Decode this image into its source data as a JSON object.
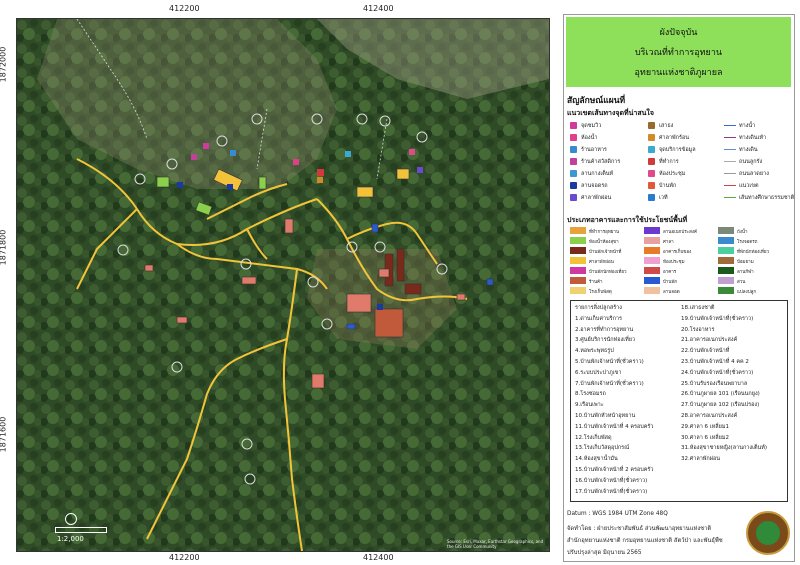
{
  "map": {
    "x_ticks": [
      "412200",
      "412400",
      "412200",
      "412400"
    ],
    "y_ticks": [
      "1872000",
      "1871800",
      "1871600",
      "1872000",
      "1871800",
      "1871600"
    ],
    "scale_label": "1:2,000",
    "attribution": "Source: Esri, Maxar, Earthstar Geographics, and the GIS User Community"
  },
  "title": {
    "line1": "ผังปัจจุบัน",
    "line2": "บริเวณที่ทำการอุทยาน",
    "line3": "อุทยานแห่งชาติภูผายล"
  },
  "legend": {
    "heading": "สัญลักษณ์แผนที่",
    "subheading": "แนวเขตเส้นทางจุดที่น่าสนใจ",
    "items": [
      {
        "label": "จุดชมวิว",
        "color": "#d03a9a"
      },
      {
        "label": "ห้องน้ำ",
        "color": "#e0408a"
      },
      {
        "label": "ร้านอาหาร",
        "color": "#3a8ad0"
      },
      {
        "label": "ร้านค้าสวัสดิการ",
        "color": "#c0409a"
      },
      {
        "label": "ลานกางเต็นท์",
        "color": "#3a9ad0"
      },
      {
        "label": "ลานจอดรถ",
        "color": "#1a3aa0"
      },
      {
        "label": "ศาลาพักผ่อน",
        "color": "#6a4ad0"
      },
      {
        "label": "เสาธง",
        "color": "#9a6a2a"
      },
      {
        "label": "ศาลาพักร้อน",
        "color": "#d08a2a"
      },
      {
        "label": "จุดบริการข้อมูล",
        "color": "#3aaad0"
      },
      {
        "label": "ที่ทำการ",
        "color": "#d03a3a"
      },
      {
        "label": "ห้องประชุม",
        "color": "#e04a8a"
      },
      {
        "label": "บ้านพัก",
        "color": "#e05a3a"
      },
      {
        "label": "เวที",
        "color": "#2a7ad0"
      }
    ],
    "lines": [
      {
        "label": "ทางน้ำ",
        "color": "#3a6ad0"
      },
      {
        "label": "ทางเดินเท้า",
        "color": "#8a3a8a"
      },
      {
        "label": "ทางเดิน",
        "color": "#6a8ad0"
      },
      {
        "label": "ถนนลูกรัง",
        "color": "#aaaaaa"
      },
      {
        "label": "ถนนลาดยาง",
        "color": "#999999"
      },
      {
        "label": "แนวเขต",
        "color": "#cc4444"
      },
      {
        "label": "เส้นทางศึกษาธรรมชาติ",
        "color": "#5aaa3a"
      }
    ]
  },
  "landuse": {
    "heading": "ประเภทอาคารและการใช้ประโยชน์พื้นที่",
    "items": [
      {
        "label": "ที่ทำการอุทยาน",
        "color": "#e8a23a"
      },
      {
        "label": "ห้องน้ำห้องสุขา",
        "color": "#8ad04a"
      },
      {
        "label": "บ้านพักเจ้าหน้าที่",
        "color": "#7a2a1a"
      },
      {
        "label": "ศาลาพักผ่อน",
        "color": "#f2c23a"
      },
      {
        "label": "บ้านพักนักท่องเที่ยว",
        "color": "#d03aa0"
      },
      {
        "label": "ร้านค้า",
        "color": "#c05a3a"
      },
      {
        "label": "โรงเก็บพัสดุ",
        "color": "#f0d070"
      },
      {
        "label": "ลานอเนกประสงค์",
        "color": "#6a3ad0"
      },
      {
        "label": "ศาลา",
        "color": "#e8a0a0"
      },
      {
        "label": "อาคารเก็บของ",
        "color": "#e87a2a"
      },
      {
        "label": "ห้องประชุม",
        "color": "#f0a0d0"
      },
      {
        "label": "อาคาร",
        "color": "#d04a4a"
      },
      {
        "label": "บ้านพัก",
        "color": "#2a5ad0"
      },
      {
        "label": "ลานจอด",
        "color": "#f0c0a0"
      },
      {
        "label": "ถังน้ำ",
        "color": "#7a8a7a"
      },
      {
        "label": "โรงจอดรถ",
        "color": "#3a8ad0"
      },
      {
        "label": "ที่พักนักท่องเที่ยว",
        "color": "#4ad0a0"
      },
      {
        "label": "ป้อมยาม",
        "color": "#a06a3a"
      },
      {
        "label": "ลานกีฬา",
        "color": "#1a5a1a"
      },
      {
        "label": "สวน",
        "color": "#c0a0d0"
      },
      {
        "label": "แปลงปลูก",
        "color": "#3a8a3a"
      }
    ]
  },
  "places": {
    "col1": [
      "รายการสิ่งปลูกสร้าง",
      "1.ด่านเก็บค่าบริการ",
      "2.อาคารที่ทำการอุทยาน",
      "3.ศูนย์บริการนักท่องเที่ยว",
      "4.หอพระพุทธรูป",
      "5.บ้านพักเจ้าหน้าที่(ชั่วคราว)",
      "6.ระบบประปาภูเขา",
      "7.บ้านพักเจ้าหน้าที่(ชั่วคราว)",
      "8.โรงซ่อมรถ",
      "9.เรือนเพาะ",
      "10.บ้านพักหัวหน้าอุทยาน",
      "11.บ้านพักเจ้าหน้าที่ 4 ครอบครัว",
      "12.โรงเก็บพัสดุ",
      "13.โรงเก็บวัสดุอุปกรณ์",
      "14.ห้องสุขาน้ำมัน",
      "15.บ้านพักเจ้าหน้าที่ 2 ครอบครัว",
      "16.บ้านพักเจ้าหน้าที่(ชั่วคราว)",
      "17.บ้านพักเจ้าหน้าที่(ชั่วคราว)"
    ],
    "col2": [
      "18.เสาธงชาติ",
      "19.บ้านพักเจ้าหน้าที่(ชั่วคราว)",
      "20.โรงอาหาร",
      "21.อาคารอเนกประสงค์",
      "22.บ้านพักเจ้าหน้าที่",
      "23.บ้านพักเจ้าหน้าที่ 4 คค 2",
      "24.บ้านพักเจ้าหน้าที่(ชั่วคราว)",
      "25.บ้านรับรองเรือนพยาบาล",
      "26.บ้านภูผายล 101 (เรือนนกยูง)",
      "27.บ้านภูผายล 102 (เรือนปรอง)",
      "28.อาคารอเนกประสงค์",
      "29.ศาลา 6 เหลี่ยม1",
      "30.ศาลา 6 เหลี่ยม2",
      "31.ห้องสุขาชายหญิง(ลานกางเต็นท์)",
      "32.ศาลาพักผ่อน"
    ]
  },
  "footer": {
    "datum": "Datum : WGS 1984 UTM Zone 48Q",
    "made_by": "จัดทำโดย : ฝ่ายประชาสัมพันธ์ ส่วนพัฒนาอุทยานแห่งชาติ",
    "dept": "สำนักอุทยานแห่งชาติ กรมอุทยานแห่งชาติ สัตว์ป่า และพันธุ์พืช",
    "updated": "ปรับปรุงล่าสุด มิถุนายน 2565"
  }
}
